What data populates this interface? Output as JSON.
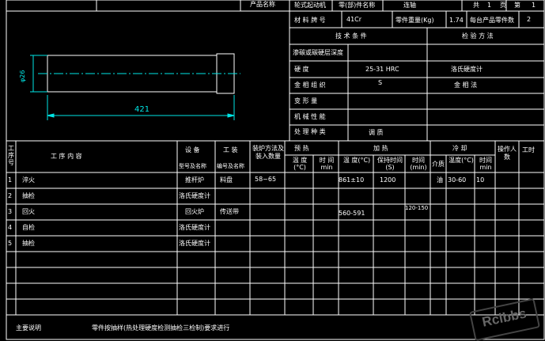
{
  "title_block": {
    "top_label_1": "产品名称",
    "top_label_2": "轮式起动机",
    "top_label_3": "零(部)件名称",
    "top_label_4": "连轴",
    "sheet_total_label": "共",
    "sheet_total_value": "1",
    "sheet_total_unit": "页",
    "sheet_no_label": "第",
    "sheet_no_value": "1"
  },
  "material": {
    "grade_label": "材 料 牌 号",
    "grade_value": "41Cr",
    "weight_label": "零件重量(Kg)",
    "weight_value": "1.74",
    "count_label": "每台产品零件数",
    "count_value": "2"
  },
  "tech_header": {
    "conditions": "技 术 条 件",
    "method": "检 验 方 法"
  },
  "tech_rows": [
    {
      "label": "渗碳或碳硬层深度",
      "value": "",
      "method": ""
    },
    {
      "label": "硬 度",
      "value": "25-31 HRC",
      "method": "洛氏硬度计"
    },
    {
      "label": "金 相 组 织",
      "value": "S",
      "method": "金 相 法"
    },
    {
      "label": "变 形 量",
      "value": "",
      "method": ""
    },
    {
      "label": "机 械 性 能",
      "value": "",
      "method": ""
    },
    {
      "label": "处 理 种 类",
      "value": "调 质",
      "method": ""
    }
  ],
  "part_drawing": {
    "diameter_label": "φ26",
    "length_label": "421"
  },
  "process_header": {
    "step_no": "工序号",
    "content": "工 序 内 容",
    "equipment": "设 备",
    "equipment_sub": "型号及名称",
    "fixture": "工 装",
    "fixture_sub": "编号及名称",
    "loading": "装炉方法及装入数量",
    "preheat": "预 热",
    "heat": "加 热",
    "cool": "冷 却",
    "workers": "操作人数",
    "hours": "工时",
    "temp": "温 度(°C)",
    "time_min": "时 间 min",
    "hold_time": "保持时间(S)",
    "time_min2": "时间(min)",
    "medium": "介质",
    "temp2": "温度(°C)",
    "time_min3": "时间min"
  },
  "process_rows": [
    {
      "no": "1",
      "content": "淬火",
      "equipment": "推杆炉",
      "fixture": "料盘",
      "loading": "58~65",
      "heat_temp": "861±10",
      "heat_hold": "1200",
      "heat_time": "",
      "medium": "油",
      "cool_temp": "30-60",
      "cool_time": "10"
    },
    {
      "no": "2",
      "content": "抽检",
      "equipment": "洛氏硬度计",
      "fixture": "",
      "loading": "",
      "heat_temp": "",
      "heat_hold": "",
      "heat_time": "",
      "medium": "",
      "cool_temp": "",
      "cool_time": ""
    },
    {
      "no": "3",
      "content": "回火",
      "equipment": "回火炉",
      "fixture": "传送带",
      "loading": "",
      "heat_temp": "560-591",
      "heat_hold": "",
      "heat_time": "120-150",
      "medium": "",
      "cool_temp": "",
      "cool_time": ""
    },
    {
      "no": "4",
      "content": "自检",
      "equipment": "洛氏硬度计",
      "fixture": "",
      "loading": "",
      "heat_temp": "",
      "heat_hold": "",
      "heat_time": "",
      "medium": "",
      "cool_temp": "",
      "cool_time": ""
    },
    {
      "no": "5",
      "content": "抽检",
      "equipment": "洛氏硬度计",
      "fixture": "",
      "loading": "",
      "heat_temp": "",
      "heat_hold": "",
      "heat_time": "",
      "medium": "",
      "cool_temp": "",
      "cool_time": ""
    }
  ],
  "notes": {
    "label": "主要说明",
    "text": "零件按抽样(热处理硬度检测抽检三检制)要求进行"
  },
  "watermark": "Rclbbs",
  "colors": {
    "background": "#000000",
    "line": "#ffffff",
    "dimension": "#00e6e6"
  }
}
